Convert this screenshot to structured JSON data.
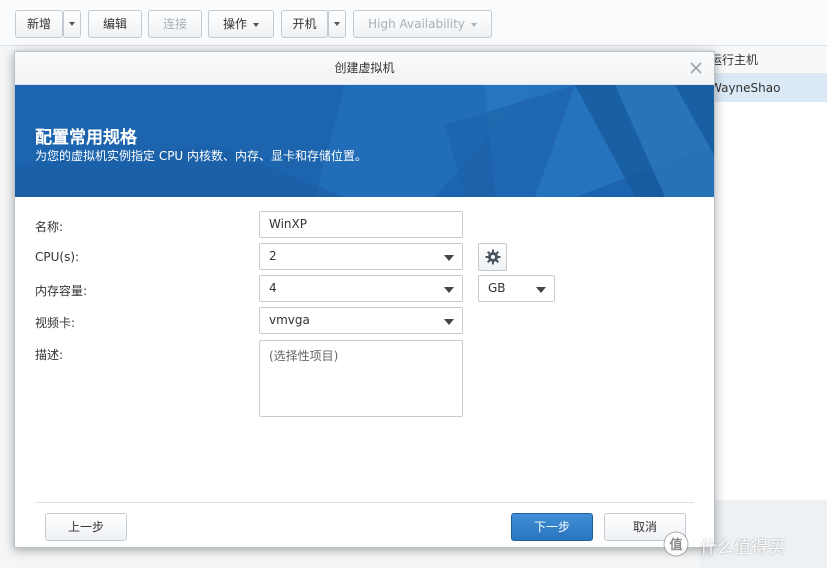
{
  "toolbar": {
    "new_label": "新增",
    "edit_label": "编辑",
    "connect_label": "连接",
    "action_label": "操作",
    "power_on_label": "开机",
    "ha_label": "High Availability"
  },
  "background_list": {
    "header_label": "运行主机",
    "selected_label": "WayneShao"
  },
  "dialog": {
    "title": "创建虚拟机",
    "banner_title": "配置常用规格",
    "banner_subtitle": "为您的虚拟机实例指定 CPU 内核数、内存、显卡和存储位置。",
    "fields": {
      "name_label": "名称:",
      "name_value": "WinXP",
      "cpu_label": "CPU(s):",
      "cpu_value": "2",
      "memory_label": "内存容量:",
      "memory_value": "4",
      "memory_unit": "GB",
      "video_label": "视频卡:",
      "video_value": "vmvga",
      "description_label": "描述:",
      "description_placeholder": "(选择性项目)"
    },
    "buttons": {
      "prev": "上一步",
      "next": "下一步",
      "cancel": "取消"
    }
  },
  "watermark": {
    "text": "什么值得买"
  },
  "colors": {
    "banner_blue": "#1c65ae",
    "primary_button": "#2a75bf"
  }
}
